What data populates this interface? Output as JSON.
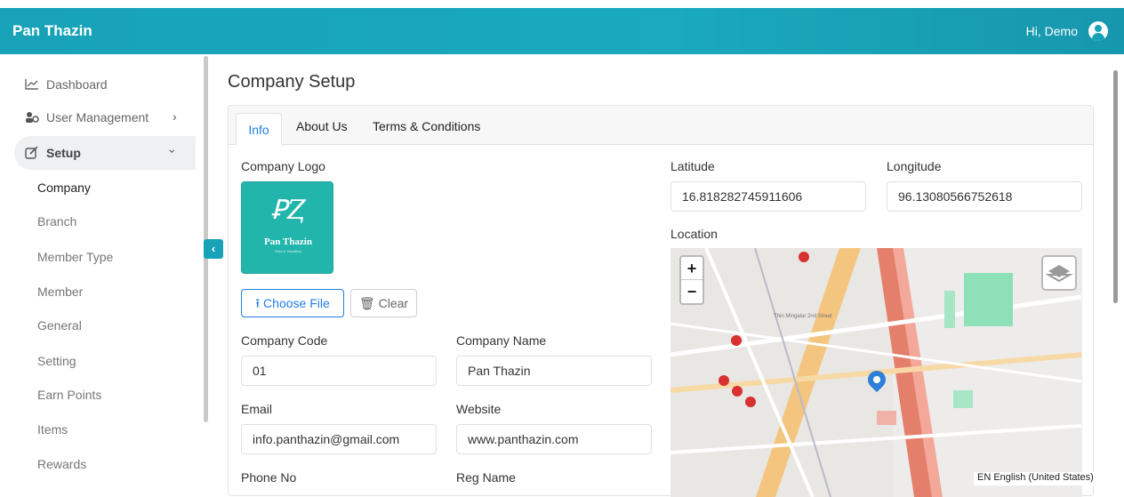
{
  "app": {
    "brand": "Pan Thazin",
    "greeting": "Hi, Demo"
  },
  "sidebar": {
    "items": [
      {
        "label": "Dashboard",
        "icon": "chart-line-icon"
      },
      {
        "label": "User Management",
        "icon": "users-icon"
      },
      {
        "label": "Setup",
        "icon": "edit-icon"
      }
    ],
    "setup_children": [
      "Company",
      "Branch",
      "Member Type",
      "Member",
      "General",
      "Setting",
      "Earn Points",
      "Items",
      "Rewards"
    ]
  },
  "page": {
    "title": "Company Setup"
  },
  "tabs": [
    "Info",
    "About Us",
    "Terms & Conditions"
  ],
  "form": {
    "company_logo_label": "Company Logo",
    "logo_text": "Pan Thazin",
    "logo_subtext": "Gold & Jewellery",
    "choose_file_label": "Choose File",
    "clear_label": "Clear",
    "company_code_label": "Company Code",
    "company_code": "01",
    "company_name_label": "Company Name",
    "company_name": "Pan Thazin",
    "email_label": "Email",
    "email": "info.panthazin@gmail.com",
    "website_label": "Website",
    "website": "www.panthazin.com",
    "phone_label": "Phone No",
    "reg_name_label": "Reg Name",
    "latitude_label": "Latitude",
    "latitude": "16.818282745911606",
    "longitude_label": "Longitude",
    "longitude": "96.13080566752618",
    "location_label": "Location"
  },
  "map": {
    "zoom_in": "+",
    "zoom_out": "−",
    "street_label": "Thin Mingalar 2nd Street"
  },
  "status": {
    "language": "EN English (United States)"
  },
  "colors": {
    "primary": "#17a2b8",
    "link": "#1f7ee8"
  }
}
